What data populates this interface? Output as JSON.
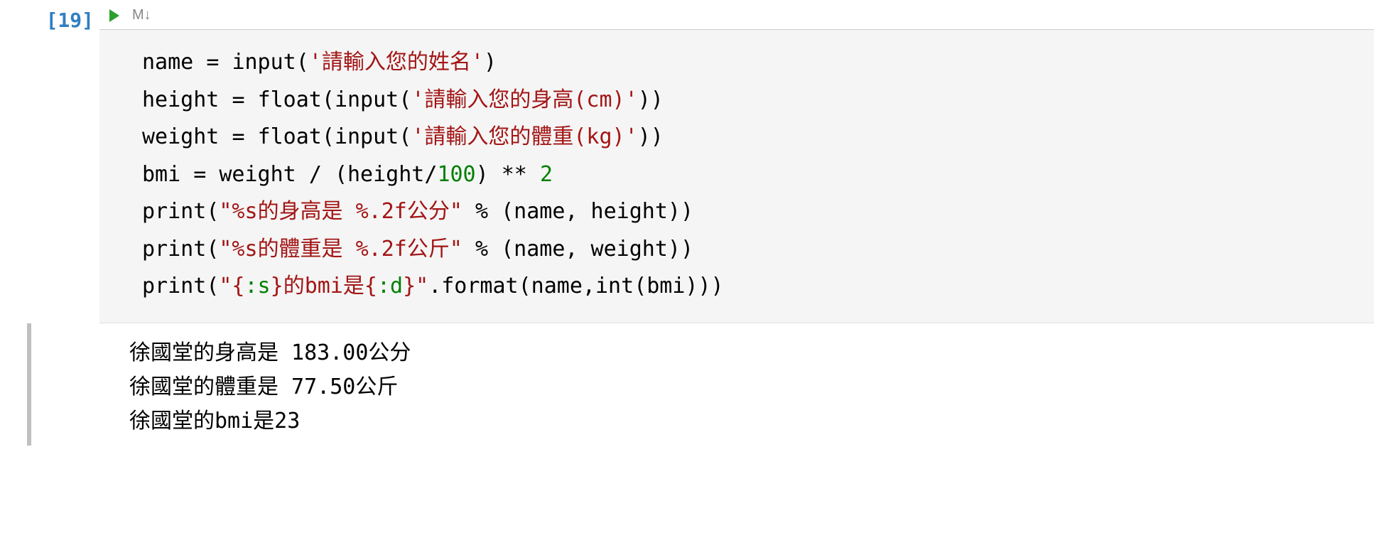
{
  "cell": {
    "execution_count": "[19]",
    "toolbar": {
      "run_tooltip": "Run",
      "markdown_label": "M↓"
    },
    "code": {
      "line1": {
        "a": "name ",
        "b": "= ",
        "c": "input",
        "d": "(",
        "e": "'請輸入您的姓名'",
        "f": ")"
      },
      "line2": {
        "a": "height ",
        "b": "= ",
        "c": "float",
        "d": "(",
        "e": "input",
        "f": "(",
        "g": "'請輸入您的身高(cm)'",
        "h": "))"
      },
      "line3": {
        "a": "weight ",
        "b": "= ",
        "c": "float",
        "d": "(",
        "e": "input",
        "f": "(",
        "g": "'請輸入您的體重(kg)'",
        "h": "))"
      },
      "line4": {
        "a": "bmi ",
        "b": "= ",
        "c": "weight ",
        "d": "/ ",
        "e": "(height",
        "f": "/",
        "g": "100",
        "h": ") ",
        "i": "** ",
        "j": "2"
      },
      "line5": {
        "a": "print",
        "b": "(",
        "c": "\"%s",
        "d": "的身高是 ",
        "e": "%.2f",
        "f": "公分\"",
        "g": " % ",
        "h": "(name, height))"
      },
      "line6": {
        "a": "print",
        "b": "(",
        "c": "\"%s",
        "d": "的體重是 ",
        "e": "%.2f",
        "f": "公斤\"",
        "g": " % ",
        "h": "(name, weight))"
      },
      "line7": {
        "a": "print",
        "b": "(",
        "c": "\"{",
        "d": ":s",
        "e": "}",
        "f": "的",
        "g": "bmi",
        "h": "是",
        "i": "{",
        "j": ":d",
        "k": "}\"",
        "l": ".format(name,",
        "m": "int",
        "n": "(bmi)))"
      }
    },
    "output": {
      "line1": "徐國堂的身高是 183.00公分",
      "line2": "徐國堂的體重是 77.50公斤",
      "line3": "徐國堂的bmi是23"
    }
  }
}
